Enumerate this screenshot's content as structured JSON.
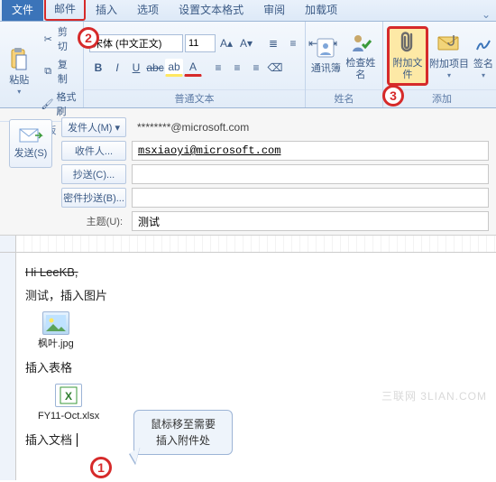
{
  "tabs": {
    "file": "文件",
    "mail": "邮件",
    "insert": "插入",
    "options": "选项",
    "format": "设置文本格式",
    "review": "审阅",
    "addins": "加载项"
  },
  "ribbon": {
    "clipboard": {
      "paste": "粘贴",
      "cut": "剪切",
      "copy": "复制",
      "fmtpaint": "格式刷",
      "group": "剪贴板"
    },
    "font": {
      "name": "宋体 (中文正文)",
      "size": "11",
      "group": "普通文本"
    },
    "names": {
      "addressbook": "通讯簿",
      "checknames": "检查姓名",
      "group": "姓名"
    },
    "include": {
      "attachfile": "附加文件",
      "attachitem": "附加项目",
      "signature": "签名",
      "group": "添加"
    }
  },
  "mailhead": {
    "send": "发送(S)",
    "from_btn": "发件人(M) ▾",
    "from_value": "********@microsoft.com",
    "to_btn": "收件人...",
    "to_value": "msxiaoyi@microsoft.com",
    "cc_btn": "抄送(C)...",
    "cc_value": "",
    "bcc_btn": "密件抄送(B)...",
    "bcc_value": "",
    "subject_label": "主题(U):",
    "subject_value": "测试"
  },
  "body": {
    "greeting": "Hi LeeKB,",
    "l1": "测试，插入图片",
    "att1": "枫叶.jpg",
    "l2": "插入表格",
    "att2": "FY11-Oct.xlsx",
    "l3": "插入文档"
  },
  "callout": {
    "line1": "鼠标移至需要",
    "line2": "插入附件处"
  },
  "steps": {
    "s1": "1",
    "s2": "2",
    "s3": "3"
  },
  "watermark": "三联网 3LIAN.COM"
}
